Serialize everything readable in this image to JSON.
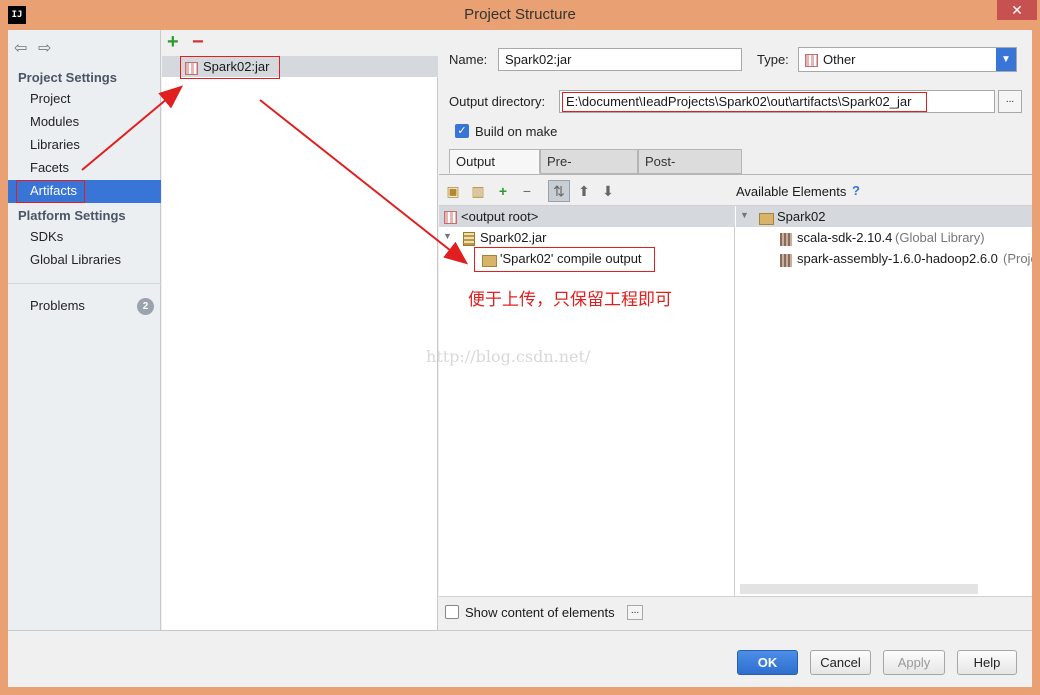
{
  "window": {
    "title": "Project Structure",
    "app_icon": "IJ",
    "close": "✕"
  },
  "nav": {
    "back_icon": "arrow-left-icon",
    "forward_icon": "arrow-right-icon",
    "section_project": "Project Settings",
    "items_project": [
      "Project",
      "Modules",
      "Libraries",
      "Facets",
      "Artifacts"
    ],
    "section_platform": "Platform Settings",
    "items_platform": [
      "SDKs",
      "Global Libraries"
    ],
    "problems": "Problems",
    "problems_count": "2",
    "selected": "Artifacts"
  },
  "artifacts_list": {
    "add": "+",
    "remove": "−",
    "items": [
      "Spark02:jar"
    ]
  },
  "form": {
    "name_label": "Name:",
    "name_value": "Spark02:jar",
    "type_label": "Type:",
    "type_value": "Other",
    "output_label": "Output directory:",
    "output_value": "E:\\document\\IeadProjects\\Spark02\\out\\artifacts\\Spark02_jar",
    "browse": "...",
    "build_on_make": "Build on make",
    "build_on_make_checked": true
  },
  "tabs": [
    "Output Layout",
    "Pre-processing",
    "Post-processing"
  ],
  "layout_tree": {
    "root": "<output root>",
    "jar": "Spark02.jar",
    "compile_output": "'Spark02' compile output"
  },
  "available": {
    "header": "Available Elements",
    "help": "?",
    "module": "Spark02",
    "libs": [
      {
        "name": "scala-sdk-2.10.4",
        "suffix": "(Global Library)"
      },
      {
        "name": "spark-assembly-1.6.0-hadoop2.6.0",
        "suffix": "(Projec"
      }
    ]
  },
  "show_content": "Show content of elements",
  "annotation": "便于上传，只保留工程即可",
  "watermark": "http://blog.csdn.net/",
  "buttons": {
    "ok": "OK",
    "cancel": "Cancel",
    "apply": "Apply",
    "help": "Help"
  },
  "colors": {
    "selection": "#3875d7",
    "annotation": "#e02020",
    "frame": "#e9a173"
  }
}
